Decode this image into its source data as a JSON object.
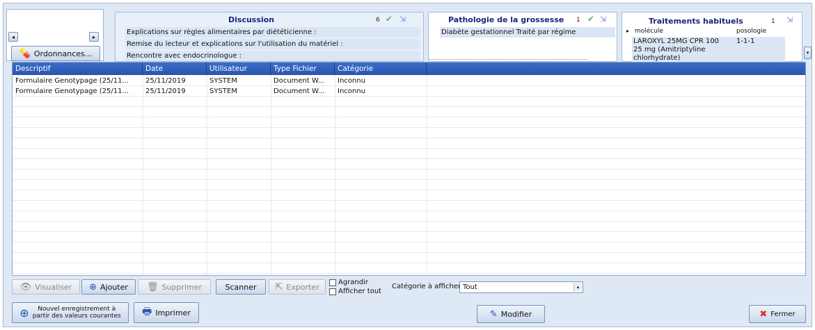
{
  "top_left": {
    "ordonnances_label": "Ordonnances..."
  },
  "discussion": {
    "title": "Discussion",
    "count": "6",
    "rows": [
      "Explications sur règles alimentaires par diététicienne :",
      "Remise du lecteur et explications sur l'utilisation du matériel :",
      "Rencontre avec endocrinologue :"
    ]
  },
  "pathologie": {
    "title": "Pathologie de la grossesse",
    "count": "1",
    "rows": [
      "Diabète gestationnel Traité par régime"
    ]
  },
  "traitements": {
    "title": "Traitements habituels",
    "count": "1",
    "columns": [
      "molécule",
      "posologie"
    ],
    "rows": [
      {
        "molecule_line1": "LAROXYL 25MG CPR 100",
        "molecule_line2": "25 mg (Amitriptyline",
        "molecule_line3": "chlorhydrate)",
        "posologie": "1-1-1"
      }
    ]
  },
  "grid": {
    "columns": [
      "Descriptif",
      "Date",
      "Utilisateur",
      "Type Fichier",
      "Catégorie"
    ],
    "rows": [
      [
        "Formulaire Genotypage (25/11...",
        "25/11/2019",
        "SYSTEM",
        "Document W...",
        "Inconnu"
      ],
      [
        "Formulaire Genotypage (25/11...",
        "25/11/2019",
        "SYSTEM",
        "Document W...",
        "Inconnu"
      ]
    ]
  },
  "toolbar": {
    "visualiser": "Visualiser",
    "ajouter": "Ajouter",
    "supprimer": "Supprimer",
    "scanner": "Scanner",
    "exporter": "Exporter",
    "agrandir": "Agrandir",
    "afficher_tout": "Afficher tout",
    "categorie_label": "Catégorie à afficher:",
    "categorie_value": "Tout"
  },
  "footer": {
    "nouvel_line1": "Nouvel enregistrement à",
    "nouvel_line2": "partir des valeurs courantes",
    "imprimer": "Imprimer",
    "modifier": "Modifier",
    "fermer": "Fermer"
  },
  "colors": {
    "header_blue": "#2f5fbf",
    "title_navy": "#1a237e",
    "check_green": "#5cb85c",
    "close_red": "#d9342b"
  }
}
